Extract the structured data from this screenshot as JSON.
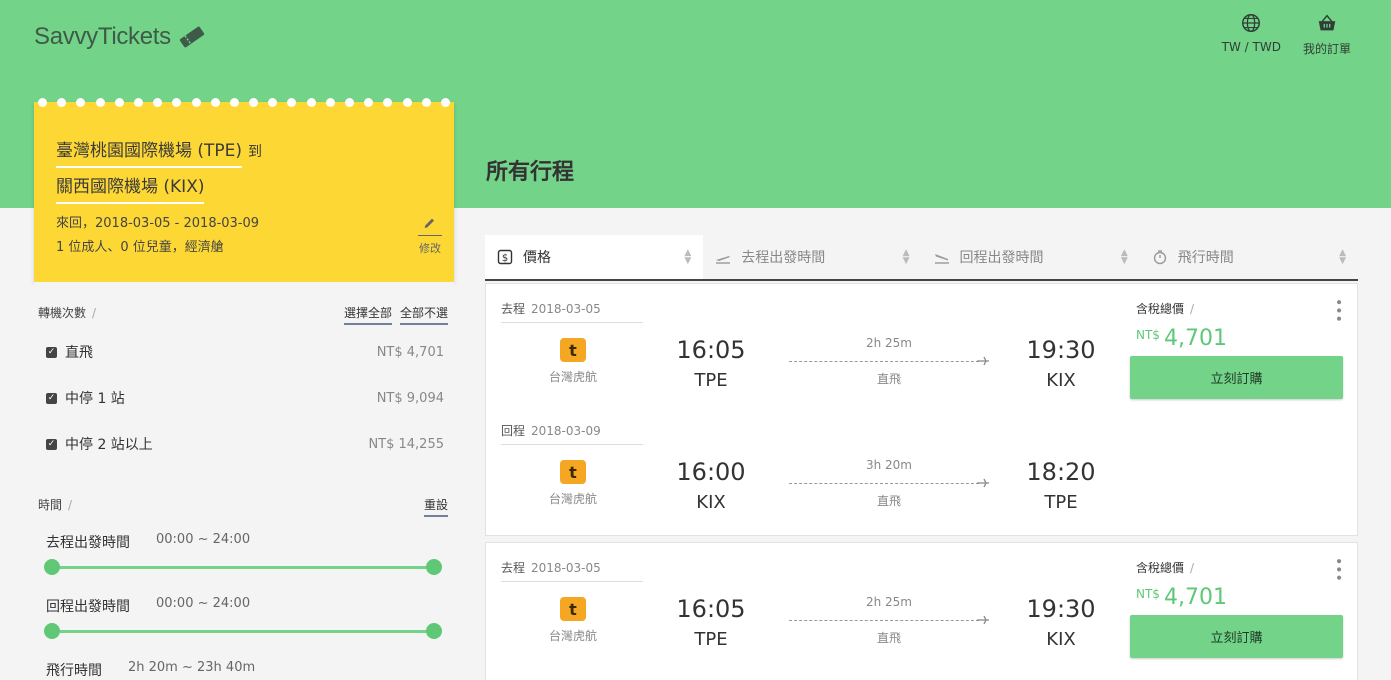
{
  "brand": {
    "name": "SavvyTickets"
  },
  "nav": {
    "region": "TW / TWD",
    "orders": "我的訂單"
  },
  "search": {
    "from": "臺灣桃園國際機場 (TPE)",
    "to_word": "到",
    "to": "關西國際機場 (KIX)",
    "dates": "來回，2018-03-05 - 2018-03-09",
    "passengers": "1 位成人、0 位兒童，經濟艙",
    "edit_label": "修改"
  },
  "filters": {
    "stops": {
      "title": "轉機次數",
      "select_all": "選擇全部",
      "select_none": "全部不選",
      "options": [
        {
          "label": "直飛",
          "price": "NT$ 4,701",
          "checked": true
        },
        {
          "label": "中停 1 站",
          "price": "NT$ 9,094",
          "checked": true
        },
        {
          "label": "中停 2 站以上",
          "price": "NT$ 14,255",
          "checked": true
        }
      ]
    },
    "time": {
      "title": "時間",
      "reset": "重設",
      "depart": {
        "label": "去程出發時間",
        "range": "00:00 ~ 24:00"
      },
      "return": {
        "label": "回程出發時間",
        "range": "00:00 ~ 24:00"
      },
      "duration": {
        "label": "飛行時間",
        "range": "2h 20m ~ 23h 40m"
      }
    }
  },
  "main": {
    "title": "所有行程",
    "sort": [
      {
        "label": "價格",
        "icon": "dollar-icon",
        "active": true
      },
      {
        "label": "去程出發時間",
        "icon": "takeoff-icon",
        "active": false
      },
      {
        "label": "回程出發時間",
        "icon": "landing-icon",
        "active": false
      },
      {
        "label": "飛行時間",
        "icon": "stopwatch-icon",
        "active": false
      }
    ],
    "results": [
      {
        "outbound": {
          "type": "去程",
          "date": "2018-03-05",
          "airline": "台灣虎航",
          "dep_time": "16:05",
          "dep_code": "TPE",
          "duration": "2h 25m",
          "stops": "直飛",
          "arr_time": "19:30",
          "arr_code": "KIX"
        },
        "inbound": {
          "type": "回程",
          "date": "2018-03-09",
          "airline": "台灣虎航",
          "dep_time": "16:00",
          "dep_code": "KIX",
          "duration": "3h 20m",
          "stops": "直飛",
          "arr_time": "18:20",
          "arr_code": "TPE"
        },
        "price_label": "含稅總價",
        "currency": "NT$",
        "price": "4,701",
        "book_label": "立刻訂購"
      },
      {
        "outbound": {
          "type": "去程",
          "date": "2018-03-05",
          "airline": "台灣虎航",
          "dep_time": "16:05",
          "dep_code": "TPE",
          "duration": "2h 25m",
          "stops": "直飛",
          "arr_time": "19:30",
          "arr_code": "KIX"
        },
        "price_label": "含稅總價",
        "currency": "NT$",
        "price": "4,701",
        "book_label": "立刻訂購"
      }
    ]
  },
  "colors": {
    "brand_green": "#73d389",
    "ticket_yellow": "#fdd835",
    "price_green": "#5fc877",
    "airline_orange": "#f5a623"
  }
}
